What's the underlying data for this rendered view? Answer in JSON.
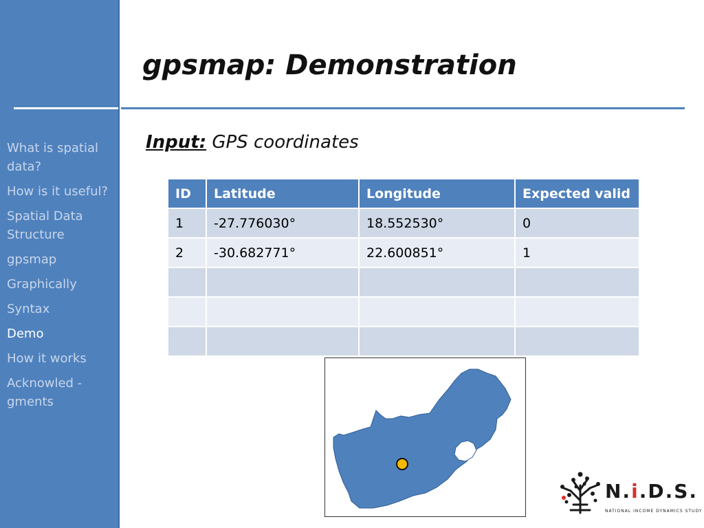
{
  "slide": {
    "title": "gpsmap: Demonstration",
    "input_label": "Input:",
    "input_text": "GPS coordinates"
  },
  "sidebar": {
    "items": [
      {
        "label": "What is spatial data?",
        "active": false
      },
      {
        "label": "How is it useful?",
        "active": false
      },
      {
        "label": "Spatial Data Structure",
        "active": false
      },
      {
        "label": "gpsmap",
        "active": false
      },
      {
        "label": "Graphically",
        "active": false
      },
      {
        "label": "Syntax",
        "active": false
      },
      {
        "label": "Demo",
        "active": true
      },
      {
        "label": "How it works",
        "active": false
      },
      {
        "label": "Acknowled - gments",
        "active": false
      }
    ]
  },
  "table": {
    "headers": [
      "ID",
      "Latitude",
      "Longitude",
      "Expected valid"
    ],
    "rows": [
      [
        "1",
        "-27.776030°",
        " 18.552530°",
        "0"
      ],
      [
        "2",
        "-30.682771°",
        " 22.600851°",
        "1"
      ],
      [
        "",
        "",
        "",
        ""
      ],
      [
        "",
        "",
        "",
        ""
      ],
      [
        "",
        "",
        "",
        ""
      ]
    ]
  },
  "map": {
    "icon": "south-africa-map",
    "fill_color": "#4f81bd",
    "marker_color": "#f5b800"
  },
  "logo": {
    "name_part1": "N.",
    "name_accent": "i",
    "name_part2": ".D.S.",
    "subtitle": "NATIONAL INCOME DYNAMICS STUDY"
  },
  "colors": {
    "accent": "#4f81bd",
    "sidebar_text": "#c7d6ea",
    "sidebar_active": "#ffffff",
    "table_header": "#4f81bd",
    "row_dark": "#cfd8e6",
    "row_light": "#e8ecf4"
  }
}
